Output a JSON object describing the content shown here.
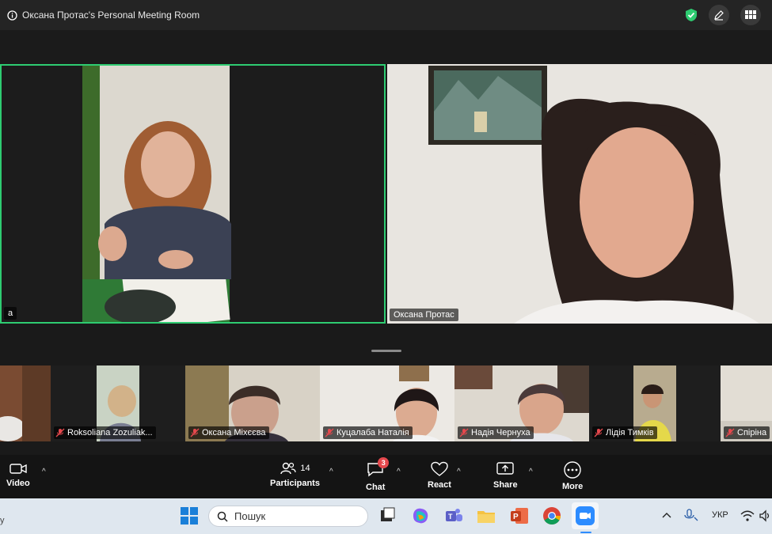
{
  "meeting": {
    "title": "Оксана Протас's Personal Meeting Room"
  },
  "speakers": [
    {
      "name": "а"
    },
    {
      "name": "Оксана Протас"
    }
  ],
  "gallery": [
    {
      "name": ""
    },
    {
      "name": "Roksoliana Zozuliak..."
    },
    {
      "name": "Оксана Міхєєва"
    },
    {
      "name": "Куцалаба  Наталія"
    },
    {
      "name": "Надія Чернуха"
    },
    {
      "name": "Лідія Тимків"
    },
    {
      "name": "Спіріна"
    }
  ],
  "toolbar": {
    "video_label": "Video",
    "participants_label": "Participants",
    "participants_count": "14",
    "chat_label": "Chat",
    "chat_badge": "3",
    "react_label": "React",
    "share_label": "Share",
    "more_label": "More"
  },
  "taskbar": {
    "search_placeholder": "Пошук",
    "language": "УКР",
    "left_edge_text": "у"
  },
  "colors": {
    "active_speaker_border": "#2ecc71",
    "shield": "#2ecc71",
    "badge": "#e5484d"
  }
}
